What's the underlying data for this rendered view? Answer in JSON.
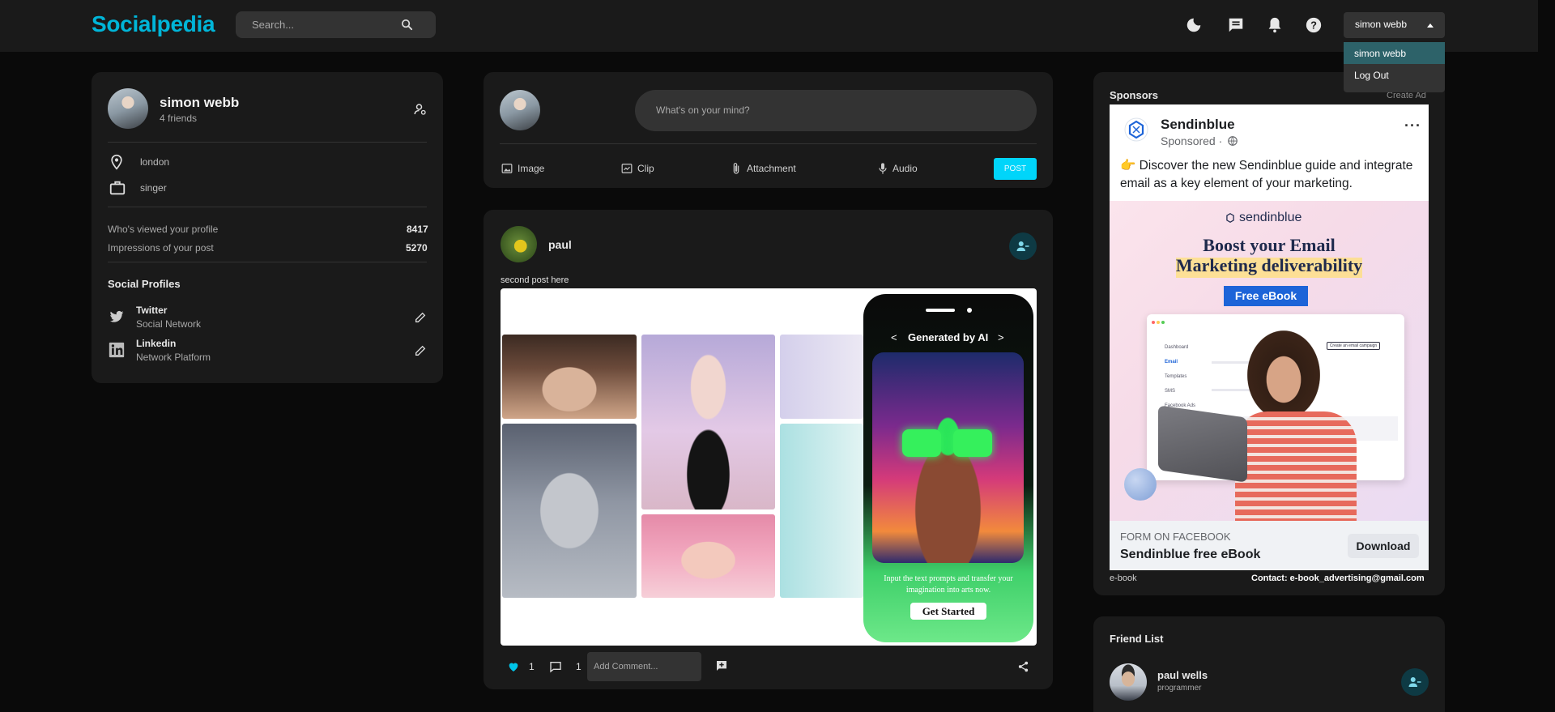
{
  "navbar": {
    "logo": "Socialpedia",
    "search_placeholder": "Search...",
    "user_select": "simon webb",
    "menu_options": [
      "simon webb",
      "Log Out"
    ]
  },
  "profile": {
    "name": "simon webb",
    "friends": "4 friends",
    "location": "london",
    "occupation": "singer",
    "viewed_label": "Who's viewed your profile",
    "viewed_value": "8417",
    "impressions_label": "Impressions of your post",
    "impressions_value": "5270",
    "social_title": "Social Profiles",
    "socials": [
      {
        "name": "Twitter",
        "sub": "Social Network"
      },
      {
        "name": "Linkedin",
        "sub": "Network Platform"
      }
    ]
  },
  "composer": {
    "placeholder": "What's on your mind?",
    "actions": [
      "Image",
      "Clip",
      "Attachment",
      "Audio"
    ],
    "post_button": "POST"
  },
  "post": {
    "author": "paul",
    "caption": "second post here",
    "likes": "1",
    "comments": "1",
    "comment_placeholder": "Add Comment...",
    "image": {
      "header": "Generated by AI",
      "prev": "<",
      "next": ">",
      "prompt_text": "Input the text prompts and transfer your imagination into arts now.",
      "cta": "Get Started"
    }
  },
  "sponsors": {
    "title": "Sponsors",
    "create_ad": "Create Ad",
    "advertiser": "Sendinblue",
    "sponsored": "Sponsored ·",
    "body": "👉 Discover the new Sendinblue guide and integrate email as a key element of your marketing.",
    "brand": "sendinblue",
    "headline_1": "Boost your Email",
    "headline_2": "Marketing deliverability",
    "badge": "Free eBook",
    "mock_menu": [
      "Dashboard",
      "Email",
      "Templates",
      "SMS",
      "Facebook Ads"
    ],
    "mock_button": "Create an email campaign",
    "form_label": "FORM ON FACEBOOK",
    "form_title": "Sendinblue free eBook",
    "download": "Download",
    "ad_type": "e-book",
    "contact": "Contact: e-book_advertising@gmail.com"
  },
  "friends": {
    "title": "Friend List",
    "items": [
      {
        "name": "paul wells",
        "role": "programmer"
      }
    ]
  },
  "colors": {
    "accent": "#00b5d8",
    "card": "#1a1a1a",
    "background": "#0a0a0a",
    "post_button": "#00d5fa"
  }
}
